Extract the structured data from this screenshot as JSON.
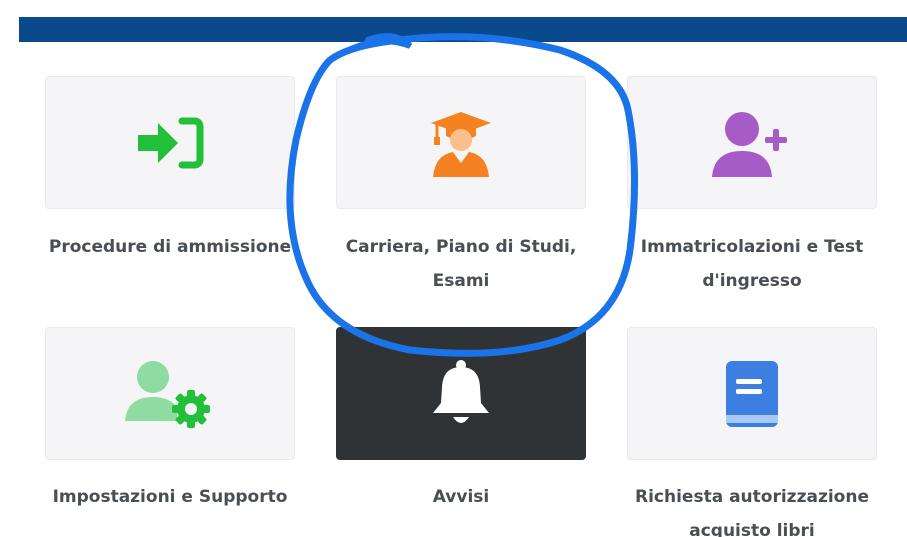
{
  "tiles": [
    {
      "label": "Procedure di ammissione",
      "icon": "sign-in-icon",
      "color": "#22c03a"
    },
    {
      "label": "Carriera, Piano di Studi, Esami",
      "icon": "graduate-icon",
      "color": "#f58220"
    },
    {
      "label": "Immatricolazioni e Test d'ingresso",
      "icon": "user-plus-icon",
      "color": "#a75bc6"
    },
    {
      "label": "Impostazioni e Supporto",
      "icon": "user-gear-icon",
      "color": "#22c03a"
    },
    {
      "label": "Avvisi",
      "icon": "bell-icon",
      "color": "#ffffff"
    },
    {
      "label": "Richiesta autorizzazione acquisto libri",
      "icon": "book-icon",
      "color": "#3d7fe0"
    }
  ],
  "colors": {
    "header": "#0a4a8c",
    "tile_bg": "#f5f5f7",
    "tile_dark_bg": "#2f3336",
    "label_text": "#4a4f55",
    "annotation": "#1a73e8"
  }
}
